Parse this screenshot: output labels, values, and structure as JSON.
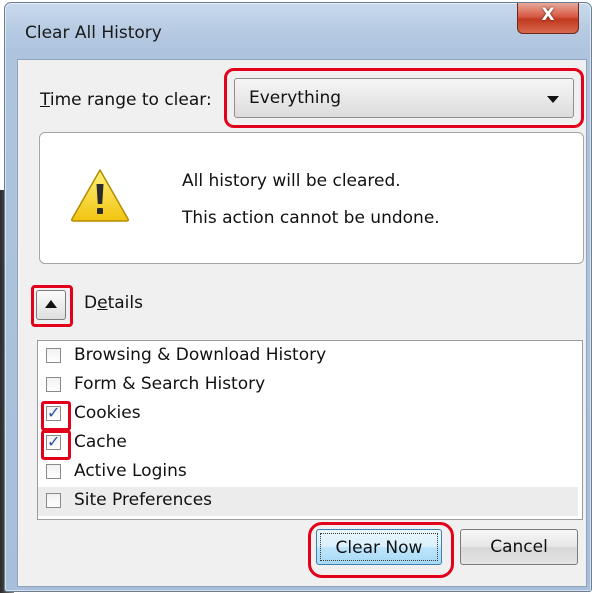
{
  "dialog": {
    "title": "Clear All History",
    "close_glyph": "X"
  },
  "time_range": {
    "label_mnemonic": "T",
    "label_rest": "ime range to clear:",
    "selected": "Everything"
  },
  "warning": {
    "icon": "warning-triangle-icon",
    "line1": "All history will be cleared.",
    "line2": "This action cannot be undone."
  },
  "details": {
    "label_pre": "D",
    "label_mnemonic": "e",
    "label_rest": "tails",
    "expanded": true
  },
  "items": [
    {
      "label": "Browsing & Download History",
      "checked": false
    },
    {
      "label": "Form & Search History",
      "checked": false
    },
    {
      "label": "Cookies",
      "checked": true
    },
    {
      "label": "Cache",
      "checked": true
    },
    {
      "label": "Active Logins",
      "checked": false
    },
    {
      "label": "Site Preferences",
      "checked": false
    }
  ],
  "buttons": {
    "clear_now": "Clear Now",
    "cancel": "Cancel"
  },
  "colors": {
    "highlight": "#e3001b",
    "checkmark": "#2853a0"
  }
}
